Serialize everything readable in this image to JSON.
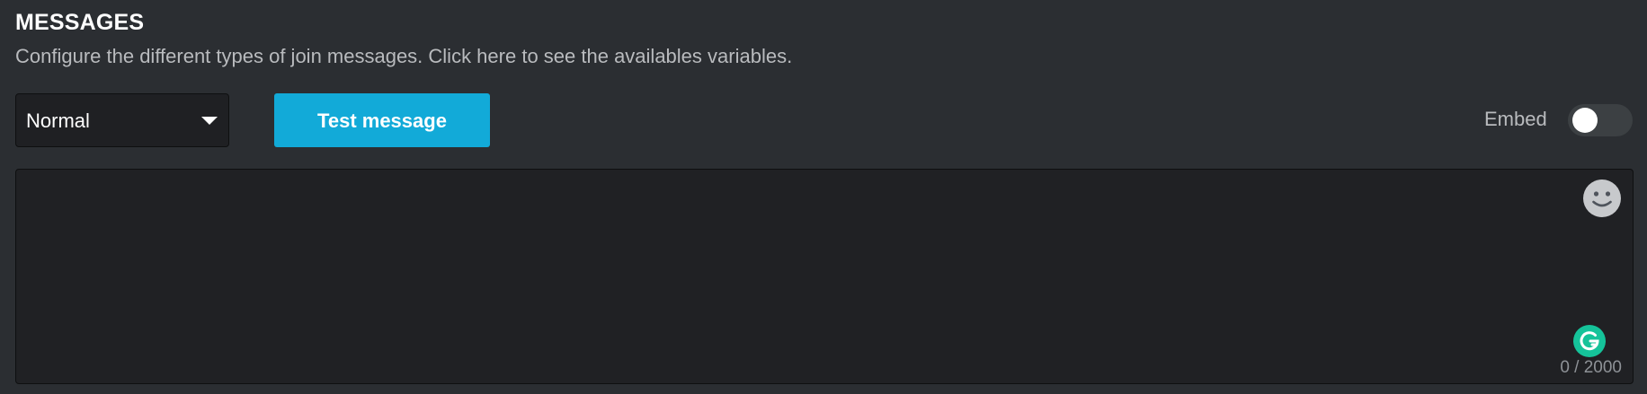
{
  "section": {
    "title": "MESSAGES",
    "description": "Configure the different types of join messages. Click here to see the availables variables."
  },
  "message_type": {
    "selected": "Normal"
  },
  "actions": {
    "test_label": "Test message"
  },
  "embed": {
    "label": "Embed",
    "enabled": false
  },
  "editor": {
    "value": "",
    "placeholder": "",
    "counter": "0 / 2000"
  },
  "icons": {
    "emoji": "smiley-face-icon",
    "grammarly": "grammarly-icon",
    "caret": "chevron-down-icon"
  },
  "colors": {
    "background": "#2b2e32",
    "accent": "#12aad8",
    "grammarly": "#15c39a"
  }
}
